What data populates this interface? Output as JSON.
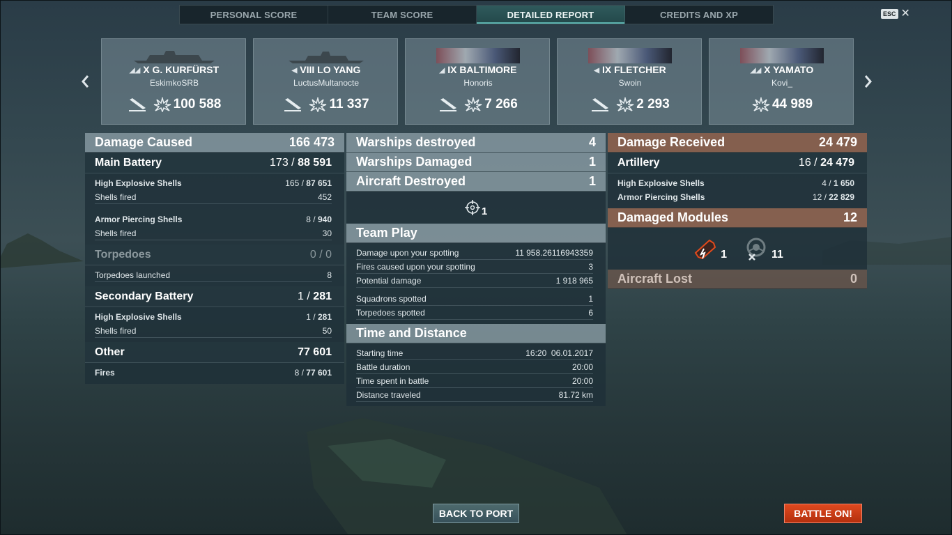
{
  "tabs": [
    {
      "label": "PERSONAL SCORE"
    },
    {
      "label": "TEAM SCORE"
    },
    {
      "label": "DETAILED REPORT",
      "active": true
    },
    {
      "label": "CREDITS AND XP"
    }
  ],
  "esc": {
    "key": "ESC",
    "close": "✕"
  },
  "ships": [
    {
      "name": "X G. KURFÜRST",
      "player": "EskimkoSRB",
      "damage": "100 588",
      "sunk_icon": true
    },
    {
      "name": "VIII LO YANG",
      "player": "LuctusMultanocte",
      "damage": "11 337",
      "sunk_icon": true
    },
    {
      "name": "IX BALTIMORE",
      "player": "Honoris",
      "damage": "7 266",
      "sunk_icon": true
    },
    {
      "name": "IX FLETCHER",
      "player": "Swoin",
      "damage": "2 293",
      "sunk_icon": true
    },
    {
      "name": "X YAMATO",
      "player": "Kovi_",
      "damage": "44 989",
      "sunk_icon": false
    }
  ],
  "damage_caused": {
    "title": "Damage Caused",
    "value": "166 473",
    "main_battery": {
      "title": "Main Battery",
      "hits": "173",
      "damage": "88 591"
    },
    "he_shells": {
      "label": "High Explosive Shells",
      "hits": "165",
      "damage": "87 651"
    },
    "he_fired": {
      "label": "Shells fired",
      "value": "452"
    },
    "ap_shells": {
      "label": "Armor Piercing Shells",
      "hits": "8",
      "damage": "940"
    },
    "ap_fired": {
      "label": "Shells fired",
      "value": "30"
    },
    "torpedoes": {
      "title": "Torpedoes",
      "value": "0 / 0"
    },
    "torp_launched": {
      "label": "Torpedoes launched",
      "value": "8"
    },
    "secondary": {
      "title": "Secondary Battery",
      "hits": "1",
      "damage": "281"
    },
    "sec_he": {
      "label": "High Explosive Shells",
      "hits": "1",
      "damage": "281"
    },
    "sec_fired": {
      "label": "Shells fired",
      "value": "50"
    },
    "other": {
      "title": "Other",
      "value": "77 601"
    },
    "fires": {
      "label": "Fires",
      "hits": "8",
      "damage": "77 601"
    }
  },
  "results": {
    "warships_destroyed": {
      "label": "Warships destroyed",
      "value": "4"
    },
    "warships_damaged": {
      "label": "Warships Damaged",
      "value": "1"
    },
    "aircraft_destroyed": {
      "label": "Aircraft Destroyed",
      "value": "1"
    },
    "spotting_count": "1"
  },
  "team_play": {
    "title": "Team Play",
    "rows": [
      {
        "label": "Damage upon your spotting",
        "value": "11 958.26116943359"
      },
      {
        "label": "Fires caused upon your spotting",
        "value": "3"
      },
      {
        "label": "Potential damage",
        "value": "1 918 965"
      },
      {
        "label": "Squadrons spotted",
        "value": "1"
      },
      {
        "label": "Torpedoes spotted",
        "value": "6"
      }
    ]
  },
  "time_distance": {
    "title": "Time and Distance",
    "rows": [
      {
        "label": "Starting time",
        "value": "16:20  06.01.2017"
      },
      {
        "label": "Battle duration",
        "value": "20:00"
      },
      {
        "label": "Time spent in battle",
        "value": "20:00"
      },
      {
        "label": "Distance traveled",
        "value": "81.72 km"
      }
    ]
  },
  "damage_received": {
    "title": "Damage Received",
    "value": "24 479",
    "artillery": {
      "title": "Artillery",
      "hits": "16",
      "damage": "24 479"
    },
    "he_shells": {
      "label": "High Explosive Shells",
      "hits": "4",
      "damage": "1 650"
    },
    "ap_shells": {
      "label": "Armor Piercing Shells",
      "hits": "12",
      "damage": "22 829"
    },
    "modules": {
      "title": "Damaged Modules",
      "value": "12"
    },
    "module_icons": [
      {
        "icon": "gun-module-icon",
        "count": "1"
      },
      {
        "icon": "rudder-module-icon",
        "count": "11"
      }
    ],
    "aircraft_lost": {
      "title": "Aircraft Lost",
      "value": "0"
    }
  },
  "buttons": {
    "back": "BACK TO PORT",
    "battle": "BATTLE ON!"
  },
  "colors": {
    "accent": "#5fb7b3",
    "battle": "#d23d16",
    "received_header": "#96644e"
  }
}
